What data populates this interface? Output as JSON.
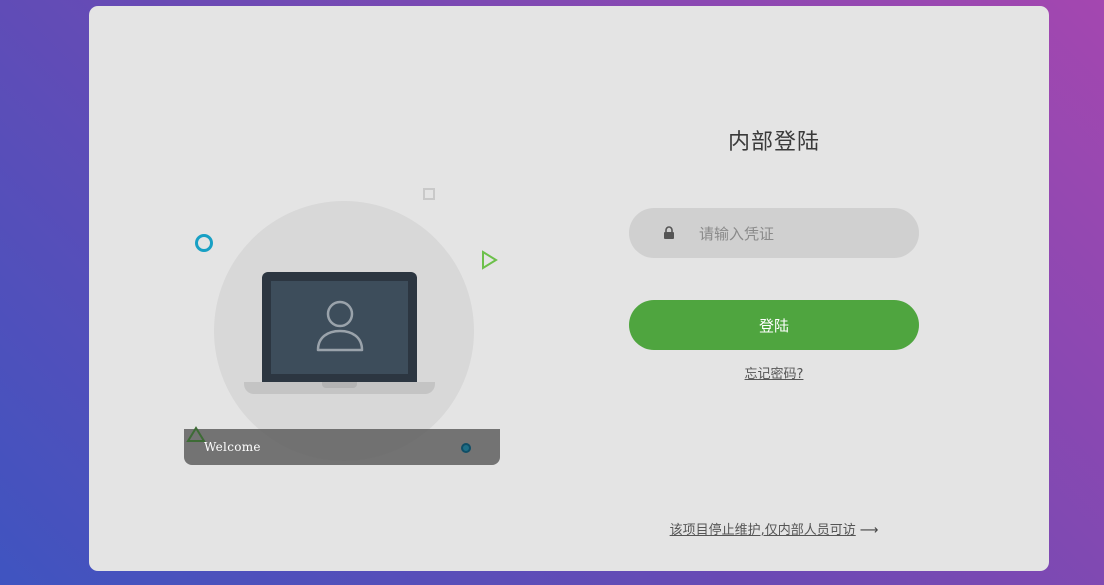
{
  "illustration": {
    "welcome_text": "Welcome",
    "icons": [
      "laptop-icon",
      "user-icon",
      "circle-shape",
      "square-shape",
      "triangle-play-shape",
      "triangle-shape",
      "dot-shape"
    ]
  },
  "login": {
    "title": "内部登陆",
    "credential_placeholder": "请输入凭证",
    "credential_value": "",
    "lock_icon": "lock-icon",
    "submit_label": "登陆",
    "forgot_label": "忘记密码?"
  },
  "footer": {
    "notice_label": "该项目停止维护,仅内部人员可访",
    "arrow": "⟶"
  },
  "colors": {
    "accent_green": "#4fa53f",
    "card_bg": "#e4e4e4",
    "input_bg": "#d0d0d0",
    "deco_cyan": "#18a0c4",
    "deco_green": "#6cc04a"
  }
}
